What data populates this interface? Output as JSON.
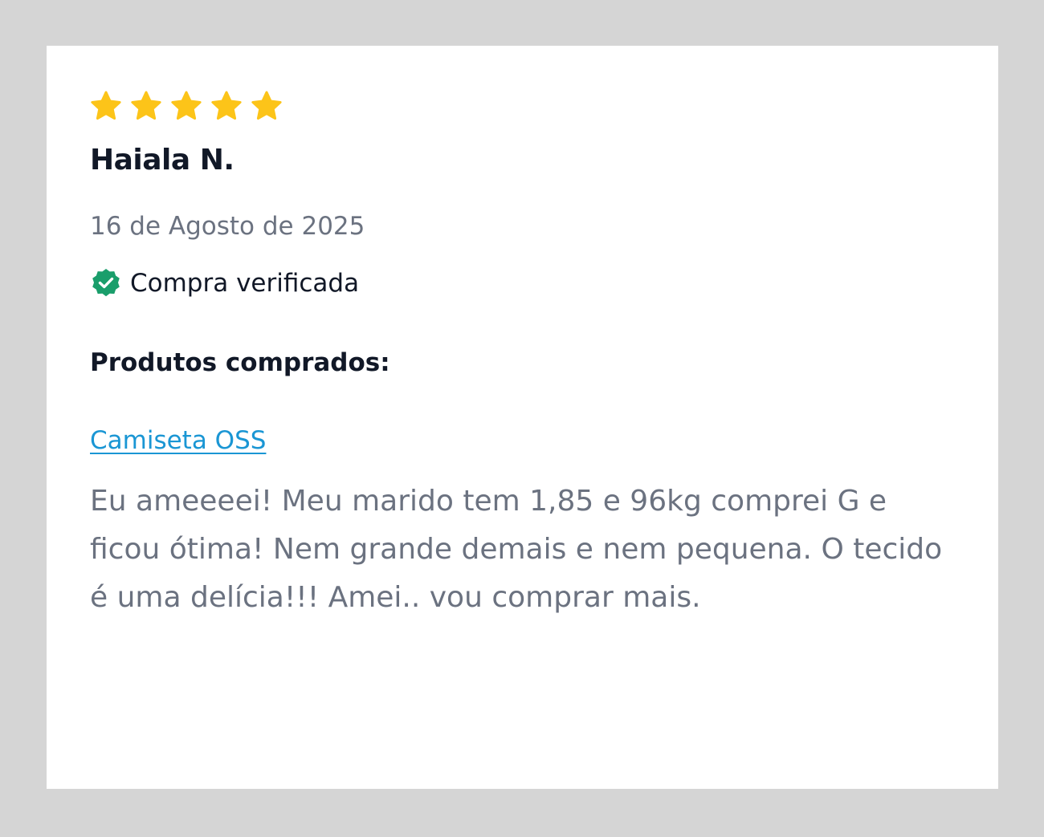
{
  "review": {
    "rating": 5,
    "rating_max": 5,
    "reviewer_name": "Haiala N.",
    "date": "16 de Agosto de 2025",
    "verified_label": "Compra verificada",
    "products_heading": "Produtos comprados:",
    "product_link": "Camiseta OSS",
    "text": "Eu ameeeei! Meu marido tem 1,85 e 96kg comprei G e ficou ótima! Nem grande demais e nem pequena. O tecido é uma delícia!!! Amei.. vou comprar mais."
  },
  "icons": {
    "star": "star-icon",
    "verified": "verified-badge-icon"
  },
  "colors": {
    "star": "#fcc419",
    "verified": "#1a9e6b",
    "link": "#1a96d4",
    "heading": "#111827",
    "muted": "#6b7280",
    "background": "#d5d5d5",
    "card": "#ffffff"
  }
}
